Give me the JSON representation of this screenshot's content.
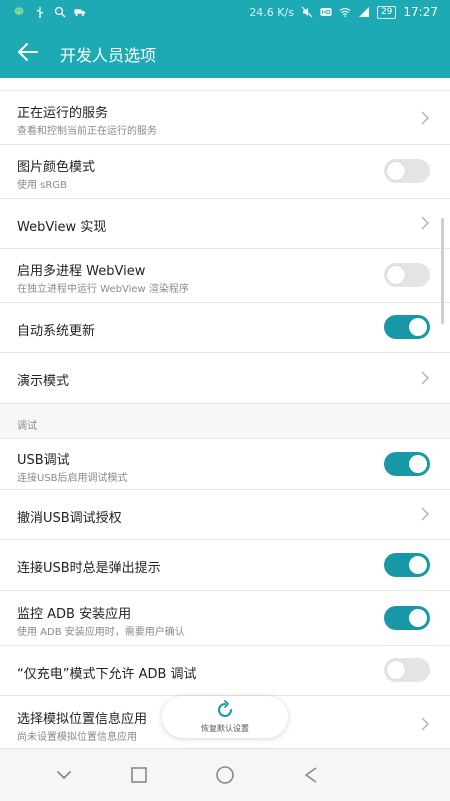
{
  "status_bar": {
    "speed": "24.6 K/s",
    "battery": "29",
    "time": "17:27",
    "icons_left": [
      "wechat-icon",
      "usb-icon",
      "search-icon",
      "truck-icon"
    ],
    "icons_right": [
      "mute-icon",
      "hd-icon",
      "wifi-icon",
      "signal-icon"
    ]
  },
  "app_bar": {
    "title": "开发人员选项",
    "back_icon": "arrow-left-icon"
  },
  "settings": {
    "running_services": {
      "title": "正在运行的服务",
      "subtitle": "查看和控制当前正在运行的服务"
    },
    "image_color_mode": {
      "title": "图片颜色模式",
      "subtitle": "使用 sRGB",
      "enabled": false
    },
    "webview_impl": {
      "title": "WebView 实现"
    },
    "multiprocess_webview": {
      "title": "启用多进程 WebView",
      "subtitle": "在独立进程中运行 WebView 渲染程序",
      "enabled": false
    },
    "auto_update": {
      "title": "自动系统更新",
      "enabled": true
    },
    "demo_mode": {
      "title": "演示模式"
    },
    "debug_section": "调试",
    "usb_debugging": {
      "title": "USB调试",
      "subtitle": "连接USB后启用调试模式",
      "enabled": true
    },
    "revoke_usb_auth": {
      "title": "撤消USB调试授权"
    },
    "usb_prompt": {
      "title": "连接USB时总是弹出提示",
      "enabled": true
    },
    "monitor_adb_install": {
      "title": "监控 ADB 安装应用",
      "subtitle": "使用 ADB 安装应用时，需要用户确认",
      "enabled": true
    },
    "charge_only_adb": {
      "title": "“仅充电”模式下允许 ADB 调试",
      "enabled": false
    },
    "mock_location": {
      "title": "选择模拟位置信息应用",
      "subtitle": "尚未设置模拟位置信息应用"
    }
  },
  "fab": {
    "label": "恢复默认设置",
    "icon": "refresh-icon"
  },
  "nav_bar": {
    "icons": [
      "back-triangle-icon",
      "home-circle-icon",
      "recents-square-icon",
      "chevron-down-icon"
    ]
  },
  "colors": {
    "accent": "#1eaab5",
    "toggle_on": "#1898a6",
    "toggle_off": "#e4e4e4"
  }
}
